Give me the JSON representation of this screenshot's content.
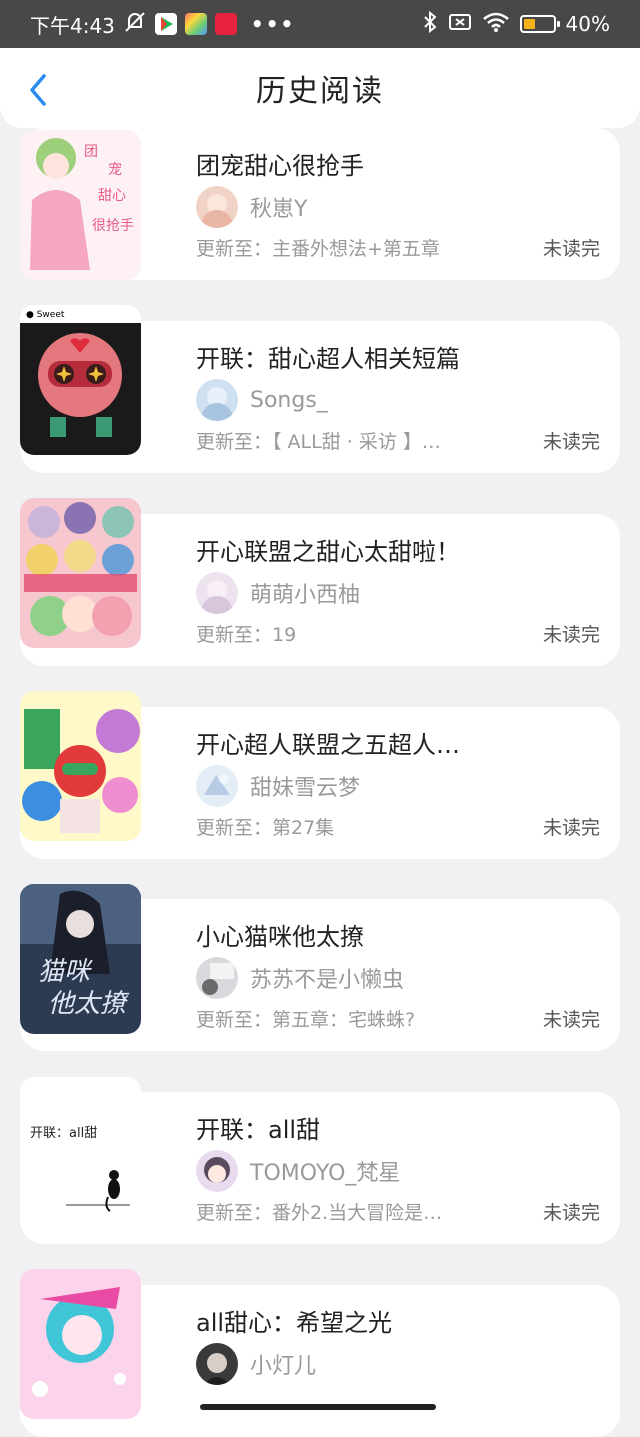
{
  "status_bar": {
    "time": "下午4:43",
    "dots": "•••",
    "battery_text": "40%",
    "battery_level": 0.4,
    "battery_color": "#f3b21b"
  },
  "header": {
    "title": "历史阅读",
    "back_icon": "chevron-left-icon",
    "accent": "#2a8cf0"
  },
  "items": [
    {
      "title": "团宠甜心很抢手",
      "author": "秋崽Y",
      "update": "更新至：主番外想法+第五章",
      "status": "未读完"
    },
    {
      "title": "开联：甜心超人相关短篇",
      "author": "Songs_",
      "update": "更新至：【 ALL甜 · 采访 】…",
      "status": "未读完"
    },
    {
      "title": "开心联盟之甜心太甜啦！",
      "author": "萌萌小西柚",
      "update": "更新至：19",
      "status": "未读完"
    },
    {
      "title": "开心超人联盟之五超人…",
      "author": "甜妹雪云梦",
      "update": "更新至：第27集",
      "status": "未读完"
    },
    {
      "title": "小心猫咪他太撩",
      "author": "苏苏不是小懒虫",
      "update": "更新至：第五章：宅蛛蛛?",
      "status": "未读完"
    },
    {
      "title": "开联：all甜",
      "author": "TOMOYO_梵星",
      "update": "更新至：番外2.当大冒险是…",
      "status": "未读完"
    },
    {
      "title": "all甜心：希望之光",
      "author": "小灯儿",
      "update": "",
      "status": ""
    }
  ]
}
